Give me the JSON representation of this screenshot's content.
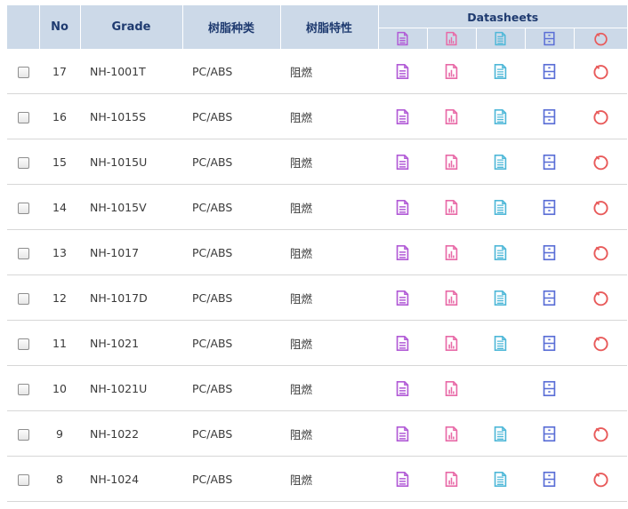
{
  "header": {
    "no": "No",
    "grade": "Grade",
    "resin_type": "树脂种类",
    "resin_property": "树脂特性",
    "datasheets": "Datasheets"
  },
  "datasheet_icons": [
    "document-purple-icon",
    "chart-doc-pink-icon",
    "document-cyan-icon",
    "cabinet-blue-icon",
    "circle-red-icon"
  ],
  "colors": {
    "header_bg": "#ccd9e8",
    "header_text": "#1f3b70",
    "icon1": "#b15ad6",
    "icon2": "#e86aa7",
    "icon3": "#4fb8d8",
    "icon4": "#5a6ed6",
    "icon5": "#e85a5a"
  },
  "rows": [
    {
      "no": "17",
      "grade": "NH-1001T",
      "type": "PC/ABS",
      "property": "阻燃",
      "icons": [
        true,
        true,
        true,
        true,
        true
      ]
    },
    {
      "no": "16",
      "grade": "NH-1015S",
      "type": "PC/ABS",
      "property": "阻燃",
      "icons": [
        true,
        true,
        true,
        true,
        true
      ]
    },
    {
      "no": "15",
      "grade": "NH-1015U",
      "type": "PC/ABS",
      "property": "阻燃",
      "icons": [
        true,
        true,
        true,
        true,
        true
      ]
    },
    {
      "no": "14",
      "grade": "NH-1015V",
      "type": "PC/ABS",
      "property": "阻燃",
      "icons": [
        true,
        true,
        true,
        true,
        true
      ]
    },
    {
      "no": "13",
      "grade": "NH-1017",
      "type": "PC/ABS",
      "property": "阻燃",
      "icons": [
        true,
        true,
        true,
        true,
        true
      ]
    },
    {
      "no": "12",
      "grade": "NH-1017D",
      "type": "PC/ABS",
      "property": "阻燃",
      "icons": [
        true,
        true,
        true,
        true,
        true
      ]
    },
    {
      "no": "11",
      "grade": "NH-1021",
      "type": "PC/ABS",
      "property": "阻燃",
      "icons": [
        true,
        true,
        true,
        true,
        true
      ]
    },
    {
      "no": "10",
      "grade": "NH-1021U",
      "type": "PC/ABS",
      "property": "阻燃",
      "icons": [
        true,
        true,
        false,
        true,
        false
      ]
    },
    {
      "no": "9",
      "grade": "NH-1022",
      "type": "PC/ABS",
      "property": "阻燃",
      "icons": [
        true,
        true,
        true,
        true,
        true
      ]
    },
    {
      "no": "8",
      "grade": "NH-1024",
      "type": "PC/ABS",
      "property": "阻燃",
      "icons": [
        true,
        true,
        true,
        true,
        true
      ]
    }
  ]
}
